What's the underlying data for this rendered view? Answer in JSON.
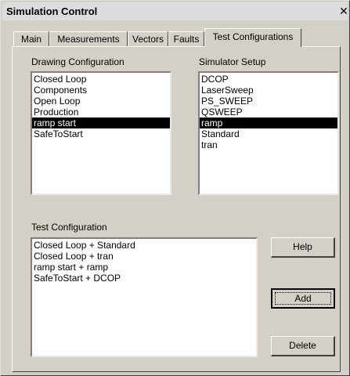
{
  "window": {
    "title": "Simulation Control",
    "close_glyph": "✕"
  },
  "tabs": [
    {
      "label": "Main",
      "active": false
    },
    {
      "label": "Measurements",
      "active": false
    },
    {
      "label": "Vectors",
      "active": false
    },
    {
      "label": "Faults",
      "active": false
    },
    {
      "label": "Test Configurations",
      "active": true
    }
  ],
  "drawing_configuration": {
    "label": "Drawing Configuration",
    "items": [
      "Closed Loop",
      "Components",
      "Open Loop",
      "Production",
      "ramp start",
      "SafeToStart"
    ],
    "selected": "ramp start"
  },
  "simulator_setup": {
    "label": "Simulator Setup",
    "items": [
      "DCOP",
      "LaserSweep",
      "PS_SWEEP",
      "QSWEEP",
      "ramp",
      "Standard",
      "tran"
    ],
    "selected": "ramp"
  },
  "test_configuration": {
    "label": "Test Configuration",
    "items": [
      "Closed Loop + Standard",
      "Closed Loop + tran",
      "ramp start + ramp",
      "SafeToStart + DCOP"
    ]
  },
  "buttons": {
    "help": "Help",
    "add": "Add",
    "delete": "Delete"
  },
  "colors": {
    "face": "#d4d0c8",
    "selection": "#000000",
    "list_bg": "#ffffff"
  }
}
